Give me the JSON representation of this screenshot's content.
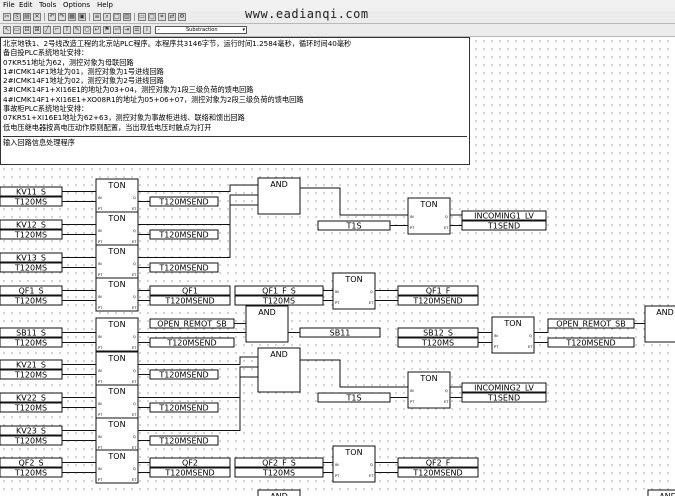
{
  "menu": {
    "file": "File",
    "edit": "Edit",
    "tools": "Tools",
    "options": "Options",
    "help": "Help"
  },
  "toolbar": {
    "block_type_combo": "Substraction"
  },
  "watermark": "www.eadianqi.com",
  "program_comment": [
    "北京地铁1、2号线改造工程的北京站PLC程序。本程序共3146字节，运行时间1.2584毫秒，循环时间40毫秒",
    "备自投PLC系统地址安排：",
    "07KR51地址为62，测控对象为母联回路",
    "1#ICMK14F1地址为01，测控对象为1号进线回路",
    "2#ICMK14F1地址为02，测控对象为2号进线回路",
    "3#ICMK14F1+XI16E1的地址为03+04，测控对象为1段三级负荷的馈电回路",
    "4#ICMK14F1+XI16E1+XO08R1的地址为05+06+07，测控对象为2段三级负荷的馈电回路",
    "事故柜PLC系统地址安排：",
    "07KR51+XI16E1地址为62+63，测控对象为事故柜进线、联络和馈出回路",
    "低电压继电器按高电压动作原则配置，当出现低电压时触点为打开"
  ],
  "block_comment": "输入回路信息处理程序",
  "blocks": {
    "ton": "TON",
    "and": "AND",
    "pin_in": "IN",
    "pin_pt": "PT",
    "pin_q": "Q",
    "pin_et": "ET"
  },
  "vars": {
    "kv11_s": "KV11_S",
    "kv12_s": "KV12_S",
    "kv13_s": "KV13_S",
    "kv21_s": "KV21_S",
    "kv22_s": "KV22_S",
    "kv23_s": "KV23_S",
    "t120ms": "T120MS",
    "t120msend": "T120MSEND",
    "qf1_s": "QF1_S",
    "qf1": "QF1",
    "qf1_f_s": "QF1_F_S",
    "qf1_f": "QF1_F",
    "qf2_s": "QF2_S",
    "qf2": "QF2",
    "qf2_f_s": "QF2_F_S",
    "qf2_f": "QF2_F",
    "sb11_s": "SB11_S",
    "sb11": "SB11",
    "sb12_s": "SB12_S",
    "open_remot_sb": "OPEN_REMOT_SB",
    "t1s": "T1S",
    "t1send": "T1SEND",
    "incoming1_lv": "INCOMING1_LV",
    "incoming2_lv": "INCOMING2_LV"
  }
}
